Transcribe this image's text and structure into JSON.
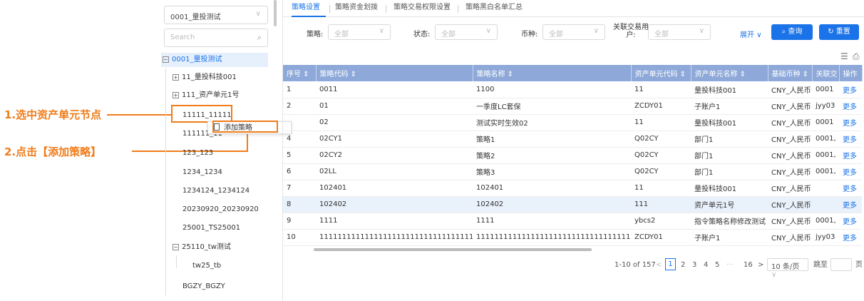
{
  "annotations": {
    "step1": "1.选中资产单元节点",
    "step2": "2.点击【添加策略】"
  },
  "tree": {
    "select_value": "0001_量投测试",
    "search_placeholder": "Search",
    "nodes": [
      {
        "label": "0001_量投测试",
        "toggle": "⊟"
      },
      {
        "label": "11_量投科技001",
        "toggle": "⊞"
      },
      {
        "label": "111_资产单元1号",
        "toggle": "⊞"
      },
      {
        "label": "11111_11111"
      },
      {
        "label": "111111_11"
      },
      {
        "label": "123_123"
      },
      {
        "label": "1234_1234"
      },
      {
        "label": "1234124_1234124"
      },
      {
        "label": "20230920_20230920"
      },
      {
        "label": "25001_TS25001"
      },
      {
        "label": "25110_tw测试",
        "toggle": "⊟"
      },
      {
        "label": "tw25_tb"
      },
      {
        "label": "BGZY_BGZY"
      }
    ],
    "context_menu": "添加策略"
  },
  "tabs": [
    "策略设置",
    "策略资金划拨",
    "策略交易权限设置",
    "策略黑白名单汇总"
  ],
  "filters": {
    "strategy_label": "策略:",
    "strategy_value": "全部",
    "status_label": "状态:",
    "status_value": "全部",
    "currency_label": "币种:",
    "currency_value": "全部",
    "account_label_1": "关联交易用",
    "account_label_2": "户:",
    "account_value": "全部",
    "expand": "展开",
    "query_btn": "查询",
    "reset_btn": "重置"
  },
  "table": {
    "headers": [
      "序号",
      "策略代码",
      "策略名称",
      "资产单元代码",
      "资产单元名称",
      "基础币种",
      "关联交",
      "操作"
    ],
    "rows": [
      [
        "1",
        "0011",
        "1100",
        "11",
        "量投科技001",
        "CNY_人民币",
        "0001",
        "更多"
      ],
      [
        "2",
        "01",
        "一季度LC套保",
        "ZCDY01",
        "子账户1",
        "CNY_人民币",
        "jyy03",
        "更多"
      ],
      [
        "",
        "02",
        "测试实时生效02",
        "11",
        "量投科技001",
        "CNY_人民币",
        "0001",
        "更多"
      ],
      [
        "4",
        "02CY1",
        "策略1",
        "Q02CY",
        "部门1",
        "CNY_人民币",
        "0001,",
        "更多"
      ],
      [
        "5",
        "02CY2",
        "策略2",
        "Q02CY",
        "部门1",
        "CNY_人民币",
        "0001,",
        "更多"
      ],
      [
        "6",
        "02LL",
        "策略3",
        "Q02CY",
        "部门1",
        "CNY_人民币",
        "0001,",
        "更多"
      ],
      [
        "7",
        "102401",
        "102401",
        "11",
        "量投科技001",
        "CNY_人民币",
        "",
        "更多"
      ],
      [
        "8",
        "102402",
        "102402",
        "111",
        "资产单元1号",
        "CNY_人民币",
        "",
        "更多"
      ],
      [
        "9",
        "1111",
        "1111",
        "ybcs2",
        "指令策略名称修改测试",
        "CNY_人民币",
        "0001,",
        "更多"
      ],
      [
        "10",
        "1111111111111111111111111111111111111111",
        "1111111111111111111111111111111111111111",
        "ZCDY01",
        "子账户1",
        "CNY_人民币",
        "jyy03",
        "更多"
      ]
    ]
  },
  "pagination": {
    "range": "1-10 of 157",
    "prev": "<",
    "current": "1",
    "pages": [
      "2",
      "3",
      "4",
      "5"
    ],
    "ellipsis": "···",
    "last": "16",
    "next": ">",
    "page_size": "10 条/页",
    "jump_label": "跳至",
    "page_unit": "页"
  }
}
